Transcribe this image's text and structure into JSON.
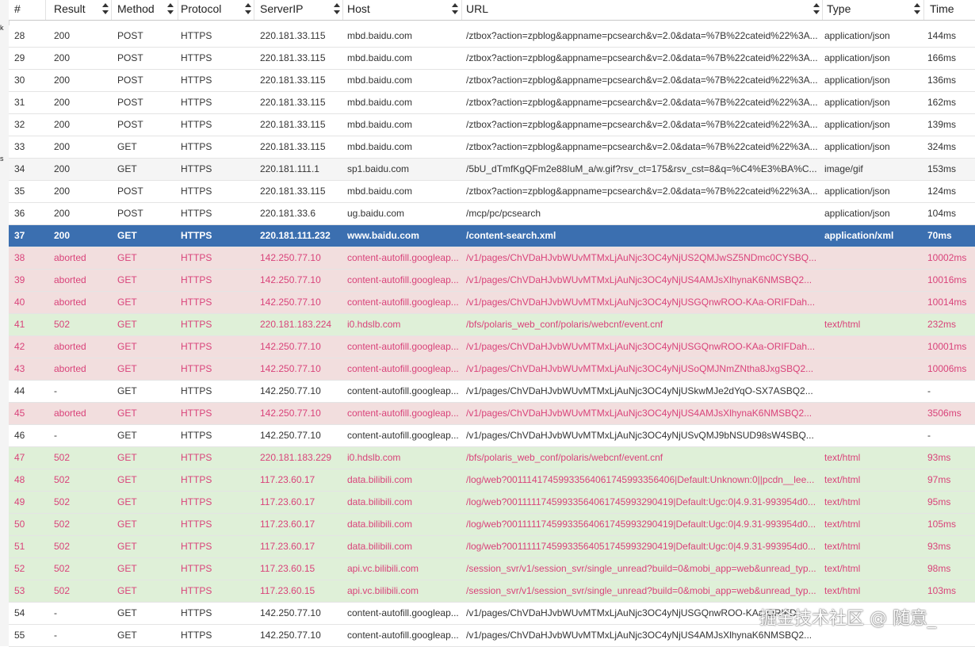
{
  "strip": {
    "mark1": "k",
    "mark2": "s"
  },
  "columns": [
    {
      "key": "num",
      "label": "#"
    },
    {
      "key": "result",
      "label": "Result"
    },
    {
      "key": "method",
      "label": "Method"
    },
    {
      "key": "protocol",
      "label": "Protocol"
    },
    {
      "key": "serverip",
      "label": "ServerIP"
    },
    {
      "key": "host",
      "label": "Host"
    },
    {
      "key": "url",
      "label": "URL"
    },
    {
      "key": "type",
      "label": "Type"
    },
    {
      "key": "time",
      "label": "Time"
    }
  ],
  "rows": [
    {
      "num": "28",
      "result": "200",
      "method": "POST",
      "protocol": "HTTPS",
      "serverip": "220.181.33.115",
      "host": "mbd.baidu.com",
      "url": "/ztbox?action=zpblog&appname=pcsearch&v=2.0&data=%7B%22cateid%22%3A...",
      "type": "application/json",
      "time": "144ms",
      "style": "normal"
    },
    {
      "num": "29",
      "result": "200",
      "method": "POST",
      "protocol": "HTTPS",
      "serverip": "220.181.33.115",
      "host": "mbd.baidu.com",
      "url": "/ztbox?action=zpblog&appname=pcsearch&v=2.0&data=%7B%22cateid%22%3A...",
      "type": "application/json",
      "time": "166ms",
      "style": "normal"
    },
    {
      "num": "30",
      "result": "200",
      "method": "POST",
      "protocol": "HTTPS",
      "serverip": "220.181.33.115",
      "host": "mbd.baidu.com",
      "url": "/ztbox?action=zpblog&appname=pcsearch&v=2.0&data=%7B%22cateid%22%3A...",
      "type": "application/json",
      "time": "136ms",
      "style": "normal"
    },
    {
      "num": "31",
      "result": "200",
      "method": "POST",
      "protocol": "HTTPS",
      "serverip": "220.181.33.115",
      "host": "mbd.baidu.com",
      "url": "/ztbox?action=zpblog&appname=pcsearch&v=2.0&data=%7B%22cateid%22%3A...",
      "type": "application/json",
      "time": "162ms",
      "style": "normal"
    },
    {
      "num": "32",
      "result": "200",
      "method": "POST",
      "protocol": "HTTPS",
      "serverip": "220.181.33.115",
      "host": "mbd.baidu.com",
      "url": "/ztbox?action=zpblog&appname=pcsearch&v=2.0&data=%7B%22cateid%22%3A...",
      "type": "application/json",
      "time": "139ms",
      "style": "normal"
    },
    {
      "num": "33",
      "result": "200",
      "method": "GET",
      "protocol": "HTTPS",
      "serverip": "220.181.33.115",
      "host": "mbd.baidu.com",
      "url": "/ztbox?action=zpblog&appname=pcsearch&v=2.0&data=%7B%22cateid%22%3A...",
      "type": "application/json",
      "time": "324ms",
      "style": "normal"
    },
    {
      "num": "34",
      "result": "200",
      "method": "GET",
      "protocol": "HTTPS",
      "serverip": "220.181.111.1",
      "host": "sp1.baidu.com",
      "url": "/5bU_dTmfKgQFm2e88IuM_a/w.gif?rsv_ct=175&rsv_cst=8&q=%C4%E3%BA%C...",
      "type": "image/gif",
      "time": "153ms",
      "style": "alt"
    },
    {
      "num": "35",
      "result": "200",
      "method": "POST",
      "protocol": "HTTPS",
      "serverip": "220.181.33.115",
      "host": "mbd.baidu.com",
      "url": "/ztbox?action=zpblog&appname=pcsearch&v=2.0&data=%7B%22cateid%22%3A...",
      "type": "application/json",
      "time": "124ms",
      "style": "normal"
    },
    {
      "num": "36",
      "result": "200",
      "method": "POST",
      "protocol": "HTTPS",
      "serverip": "220.181.33.6",
      "host": "ug.baidu.com",
      "url": "/mcp/pc/pcsearch",
      "type": "application/json",
      "time": "104ms",
      "style": "normal"
    },
    {
      "num": "37",
      "result": "200",
      "method": "GET",
      "protocol": "HTTPS",
      "serverip": "220.181.111.232",
      "host": "www.baidu.com",
      "url": "/content-search.xml",
      "type": "application/xml",
      "time": "70ms",
      "style": "selected"
    },
    {
      "num": "38",
      "result": "aborted",
      "method": "GET",
      "protocol": "HTTPS",
      "serverip": "142.250.77.10",
      "host": "content-autofill.googleap...",
      "url": "/v1/pages/ChVDaHJvbWUvMTMxLjAuNjc3OC4yNjUS2QMJwSZ5NDmc0CYSBQ...",
      "type": "",
      "time": "10002ms",
      "style": "error"
    },
    {
      "num": "39",
      "result": "aborted",
      "method": "GET",
      "protocol": "HTTPS",
      "serverip": "142.250.77.10",
      "host": "content-autofill.googleap...",
      "url": "/v1/pages/ChVDaHJvbWUvMTMxLjAuNjc3OC4yNjUS4AMJsXlhynaK6NMSBQ2...",
      "type": "",
      "time": "10016ms",
      "style": "error"
    },
    {
      "num": "40",
      "result": "aborted",
      "method": "GET",
      "protocol": "HTTPS",
      "serverip": "142.250.77.10",
      "host": "content-autofill.googleap...",
      "url": "/v1/pages/ChVDaHJvbWUvMTMxLjAuNjc3OC4yNjUSGQnwROO-KAa-ORIFDah...",
      "type": "",
      "time": "10014ms",
      "style": "error"
    },
    {
      "num": "41",
      "result": "502",
      "method": "GET",
      "protocol": "HTTPS",
      "serverip": "220.181.183.224",
      "host": "i0.hdslb.com",
      "url": "/bfs/polaris_web_conf/polaris/webcnf/event.cnf",
      "type": "text/html",
      "time": "232ms",
      "style": "warn"
    },
    {
      "num": "42",
      "result": "aborted",
      "method": "GET",
      "protocol": "HTTPS",
      "serverip": "142.250.77.10",
      "host": "content-autofill.googleap...",
      "url": "/v1/pages/ChVDaHJvbWUvMTMxLjAuNjc3OC4yNjUSGQnwROO-KAa-ORIFDah...",
      "type": "",
      "time": "10001ms",
      "style": "error"
    },
    {
      "num": "43",
      "result": "aborted",
      "method": "GET",
      "protocol": "HTTPS",
      "serverip": "142.250.77.10",
      "host": "content-autofill.googleap...",
      "url": "/v1/pages/ChVDaHJvbWUvMTMxLjAuNjc3OC4yNjUSoQMJNmZNtha8JxgSBQ2...",
      "type": "",
      "time": "10006ms",
      "style": "error"
    },
    {
      "num": "44",
      "result": "-",
      "method": "GET",
      "protocol": "HTTPS",
      "serverip": "142.250.77.10",
      "host": "content-autofill.googleap...",
      "url": "/v1/pages/ChVDaHJvbWUvMTMxLjAuNjc3OC4yNjUSkwMJe2dYqO-SX7ASBQ2...",
      "type": "",
      "time": "-",
      "style": "normal"
    },
    {
      "num": "45",
      "result": "aborted",
      "method": "GET",
      "protocol": "HTTPS",
      "serverip": "142.250.77.10",
      "host": "content-autofill.googleap...",
      "url": "/v1/pages/ChVDaHJvbWUvMTMxLjAuNjc3OC4yNjUS4AMJsXlhynaK6NMSBQ2...",
      "type": "",
      "time": "3506ms",
      "style": "error"
    },
    {
      "num": "46",
      "result": "-",
      "method": "GET",
      "protocol": "HTTPS",
      "serverip": "142.250.77.10",
      "host": "content-autofill.googleap...",
      "url": "/v1/pages/ChVDaHJvbWUvMTMxLjAuNjc3OC4yNjUSvQMJ9bNSUD98sW4SBQ...",
      "type": "",
      "time": "-",
      "style": "normal"
    },
    {
      "num": "47",
      "result": "502",
      "method": "GET",
      "protocol": "HTTPS",
      "serverip": "220.181.183.229",
      "host": "i0.hdslb.com",
      "url": "/bfs/polaris_web_conf/polaris/webcnf/event.cnf",
      "type": "text/html",
      "time": "93ms",
      "style": "warn"
    },
    {
      "num": "48",
      "result": "502",
      "method": "GET",
      "protocol": "HTTPS",
      "serverip": "117.23.60.17",
      "host": "data.bilibili.com",
      "url": "/log/web?001114174599335640617459933564​06|Default:Unknown:0||pcdn__lee...",
      "type": "text/html",
      "time": "97ms",
      "style": "warn"
    },
    {
      "num": "49",
      "result": "502",
      "method": "GET",
      "protocol": "HTTPS",
      "serverip": "117.23.60.17",
      "host": "data.bilibili.com",
      "url": "/log/web?00111117459933564061745993290419|Default:Ugc:0|4.9.31-993954d0...",
      "type": "text/html",
      "time": "95ms",
      "style": "warn"
    },
    {
      "num": "50",
      "result": "502",
      "method": "GET",
      "protocol": "HTTPS",
      "serverip": "117.23.60.17",
      "host": "data.bilibili.com",
      "url": "/log/web?00111117459933564061745993290419|Default:Ugc:0|4.9.31-993954d0...",
      "type": "text/html",
      "time": "105ms",
      "style": "warn"
    },
    {
      "num": "51",
      "result": "502",
      "method": "GET",
      "protocol": "HTTPS",
      "serverip": "117.23.60.17",
      "host": "data.bilibili.com",
      "url": "/log/web?00111117459933564051745993290419|Default:Ugc:0|4.9.31-993954d0...",
      "type": "text/html",
      "time": "93ms",
      "style": "warn"
    },
    {
      "num": "52",
      "result": "502",
      "method": "GET",
      "protocol": "HTTPS",
      "serverip": "117.23.60.15",
      "host": "api.vc.bilibili.com",
      "url": "/session_svr/v1/session_svr/single_unread?build=0&mobi_app=web&unread_typ...",
      "type": "text/html",
      "time": "98ms",
      "style": "warn"
    },
    {
      "num": "53",
      "result": "502",
      "method": "GET",
      "protocol": "HTTPS",
      "serverip": "117.23.60.15",
      "host": "api.vc.bilibili.com",
      "url": "/session_svr/v1/session_svr/single_unread?build=0&mobi_app=web&unread_typ...",
      "type": "text/html",
      "time": "103ms",
      "style": "warn"
    },
    {
      "num": "54",
      "result": "-",
      "method": "GET",
      "protocol": "HTTPS",
      "serverip": "142.250.77.10",
      "host": "content-autofill.googleap...",
      "url": "/v1/pages/ChVDaHJvbWUvMTMxLjAuNjc3OC4yNjUSGQnwROO-KAa-ORIFD",
      "type": "",
      "time": "",
      "style": "normal"
    },
    {
      "num": "55",
      "result": "-",
      "method": "GET",
      "protocol": "HTTPS",
      "serverip": "142.250.77.10",
      "host": "content-autofill.googleap...",
      "url": "/v1/pages/ChVDaHJvbWUvMTMxLjAuNjc3OC4yNjUS4AMJsXlhynaK6NMSBQ2...",
      "type": "",
      "time": "",
      "style": "normal"
    }
  ],
  "watermark": "掘金技术社区 @ 随意_"
}
